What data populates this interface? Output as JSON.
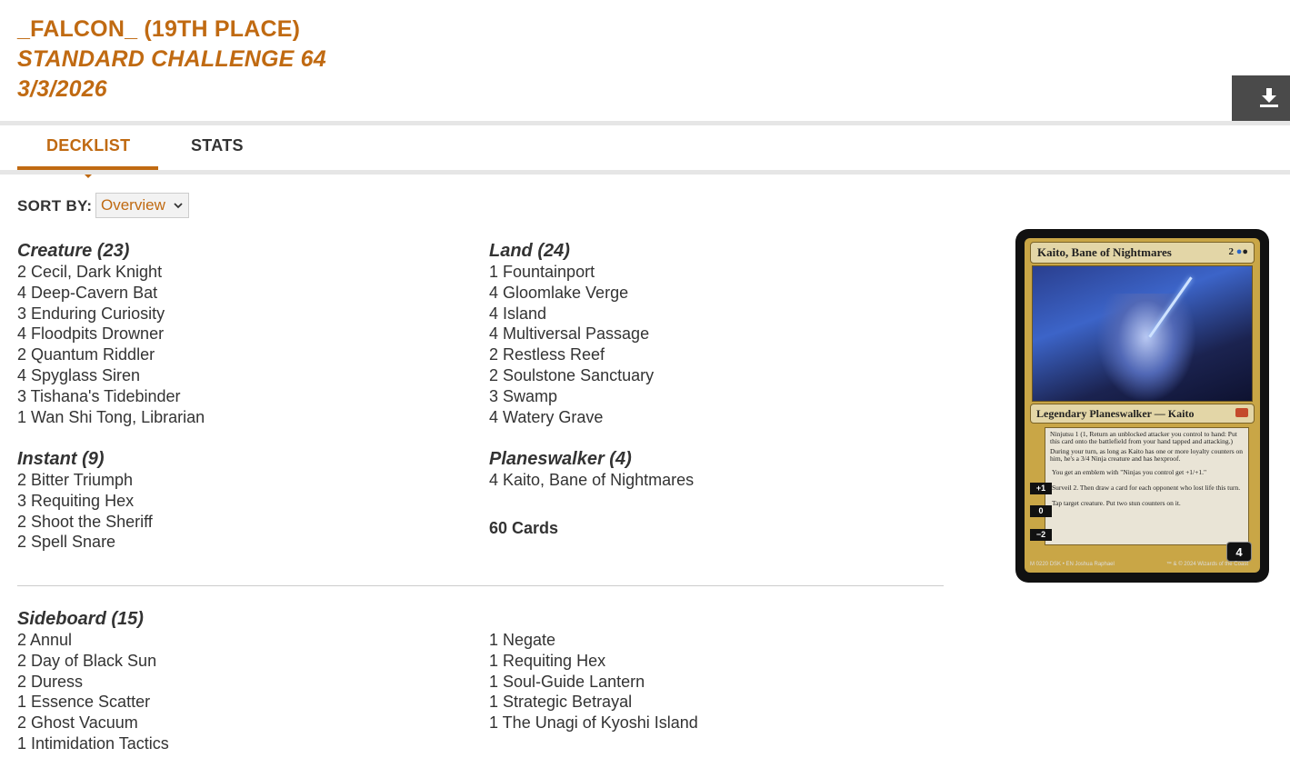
{
  "header": {
    "player": "_FALCON_ (19TH PLACE)",
    "event": "STANDARD CHALLENGE 64",
    "date": "3/3/2026"
  },
  "tabs": [
    {
      "label": "DECKLIST",
      "active": true
    },
    {
      "label": "STATS",
      "active": false
    }
  ],
  "sort": {
    "label": "SORT BY:",
    "selected": "Overview"
  },
  "sections": {
    "creature": {
      "title": "Creature (23)",
      "cards": [
        "2 Cecil, Dark Knight",
        "4 Deep-Cavern Bat",
        "3 Enduring Curiosity",
        "4 Floodpits Drowner",
        "2 Quantum Riddler",
        "4 Spyglass Siren",
        "3 Tishana's Tidebinder",
        "1 Wan Shi Tong, Librarian"
      ]
    },
    "instant": {
      "title": "Instant (9)",
      "cards": [
        "2 Bitter Triumph",
        "3 Requiting Hex",
        "2 Shoot the Sheriff",
        "2 Spell Snare"
      ]
    },
    "land": {
      "title": "Land (24)",
      "cards": [
        "1 Fountainport",
        "4 Gloomlake Verge",
        "4 Island",
        "4 Multiversal Passage",
        "2 Restless Reef",
        "2 Soulstone Sanctuary",
        "3 Swamp",
        "4 Watery Grave"
      ]
    },
    "planeswalker": {
      "title": "Planeswalker (4)",
      "cards": [
        "4 Kaito, Bane of Nightmares"
      ]
    },
    "sideboard": {
      "title": "Sideboard (15)",
      "cards_left": [
        "2 Annul",
        "2 Day of Black Sun",
        "2 Duress",
        "1 Essence Scatter",
        "2 Ghost Vacuum",
        "1 Intimidation Tactics"
      ],
      "cards_right": [
        "1 Negate",
        "1 Requiting Hex",
        "1 Soul-Guide Lantern",
        "1 Strategic Betrayal",
        "1 The Unagi of Kyoshi Island"
      ]
    }
  },
  "total": "60 Cards",
  "card_preview": {
    "name": "Kaito, Bane of Nightmares",
    "mana_cost": "2",
    "type_line": "Legendary Planeswalker — Kaito",
    "rules": [
      "Ninjutsu 1 (1, Return an unblocked attacker you control to hand: Put this card onto the battlefield from your hand tapped and attacking.)",
      "During your turn, as long as Kaito has one or more loyalty counters on him, he's a 3/4 Ninja creature and has hexproof."
    ],
    "abilities": [
      {
        "cost": "+1",
        "text": "You get an emblem with \"Ninjas you control get +1/+1.\""
      },
      {
        "cost": "0",
        "text": "Surveil 2. Then draw a card for each opponent who lost life this turn."
      },
      {
        "cost": "−2",
        "text": "Tap target creature. Put two stun counters on it."
      }
    ],
    "loyalty": "4",
    "collector": "M 0220",
    "set_line": "DSK • EN",
    "artist": "Joshua Raphael",
    "copyright": "™ & © 2024 Wizards of the Coast"
  },
  "colors": {
    "accent": "#c06a12",
    "text": "#333333",
    "download_bg": "#4a4a4a"
  },
  "icons": {
    "download": "download-icon",
    "dropdown": "chevron-down-icon"
  }
}
